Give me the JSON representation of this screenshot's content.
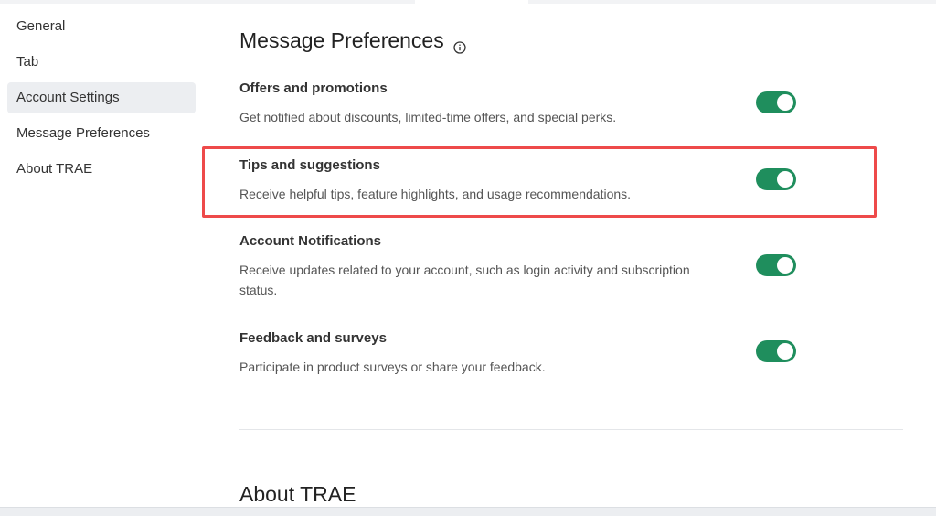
{
  "sidebar": {
    "items": [
      {
        "label": "General",
        "active": false
      },
      {
        "label": "Tab",
        "active": false
      },
      {
        "label": "Account Settings",
        "active": true
      },
      {
        "label": "Message Preferences",
        "active": false
      },
      {
        "label": "About TRAE",
        "active": false
      }
    ]
  },
  "main": {
    "section_title": "Message Preferences",
    "info_icon": "info-circle-icon",
    "preferences": [
      {
        "title": "Offers and promotions",
        "description": "Get notified about discounts, limited-time offers, and special perks.",
        "enabled": true
      },
      {
        "title": "Tips and suggestions",
        "description": "Receive helpful tips, feature highlights, and usage recommendations.",
        "enabled": true,
        "highlighted": true
      },
      {
        "title": "Account Notifications",
        "description": "Receive updates related to your account, such as login activity and subscription status.",
        "enabled": true
      },
      {
        "title": "Feedback and surveys",
        "description": "Participate in product surveys or share your feedback.",
        "enabled": true
      }
    ],
    "about_title": "About TRAE"
  },
  "colors": {
    "toggle_on": "#1f8e5d",
    "highlight": "#ee4a4a",
    "sidebar_active_bg": "#eceef1"
  }
}
